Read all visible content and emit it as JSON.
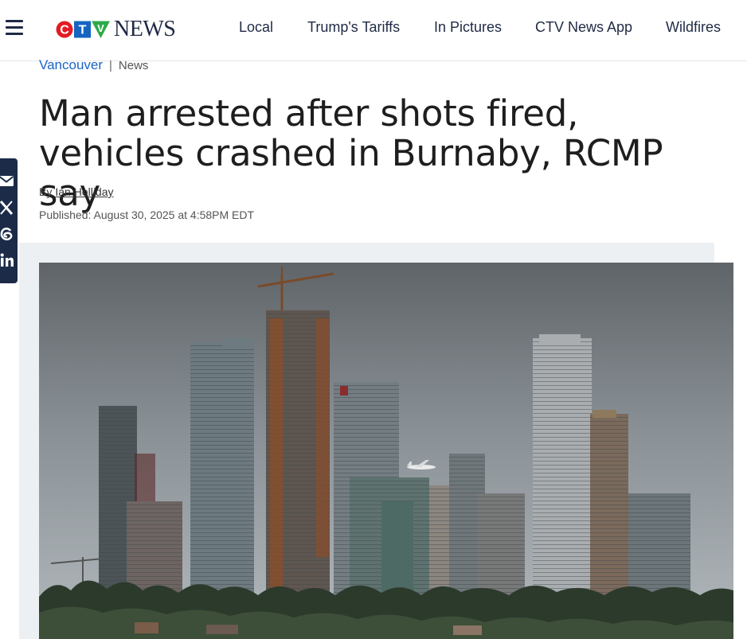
{
  "header": {
    "logo": {
      "letters": [
        "C",
        "T",
        "V"
      ],
      "word": "NEWS",
      "colors": {
        "red": "#e31b23",
        "blue": "#1565c0",
        "green": "#2eaa4a",
        "navy": "#1f2a44"
      }
    },
    "nav": [
      {
        "label": "Local"
      },
      {
        "label": "Trump's Tariffs"
      },
      {
        "label": "In Pictures"
      },
      {
        "label": "CTV News App"
      },
      {
        "label": "Wildfires"
      }
    ]
  },
  "breadcrumb": {
    "section": "Vancouver",
    "separator": "|",
    "sub": "News"
  },
  "article": {
    "title": "Man arrested after shots fired, vehicles crashed in Burnaby, RCMP say",
    "byline_prefix": "By",
    "author": "Ian Holliday",
    "published": "Published: August 30, 2025 at 4:58PM EDT"
  },
  "share": {
    "icons": [
      "email-icon",
      "x-icon",
      "threads-icon",
      "linkedin-icon"
    ]
  },
  "colors": {
    "accent": "#1a64c8",
    "rail": "#1b2b48"
  }
}
